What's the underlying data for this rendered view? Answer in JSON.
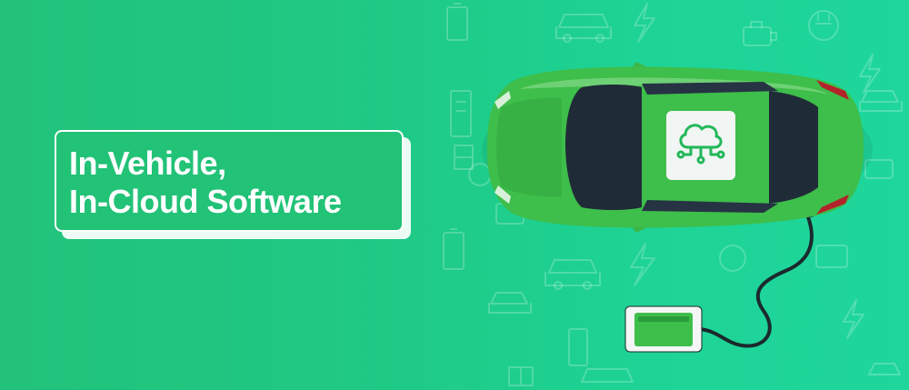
{
  "banner": {
    "title_lines": [
      "In-Vehicle,",
      "In-Cloud Software"
    ],
    "colors": {
      "background": "#22c27a",
      "car_body": "#3ebe4a",
      "car_glass": "#1f2b38",
      "text": "#ffffff"
    },
    "icons": [
      "cloud-network-icon",
      "lightning-icon",
      "plug-icon",
      "car-outline-icon",
      "battery-icon"
    ]
  }
}
